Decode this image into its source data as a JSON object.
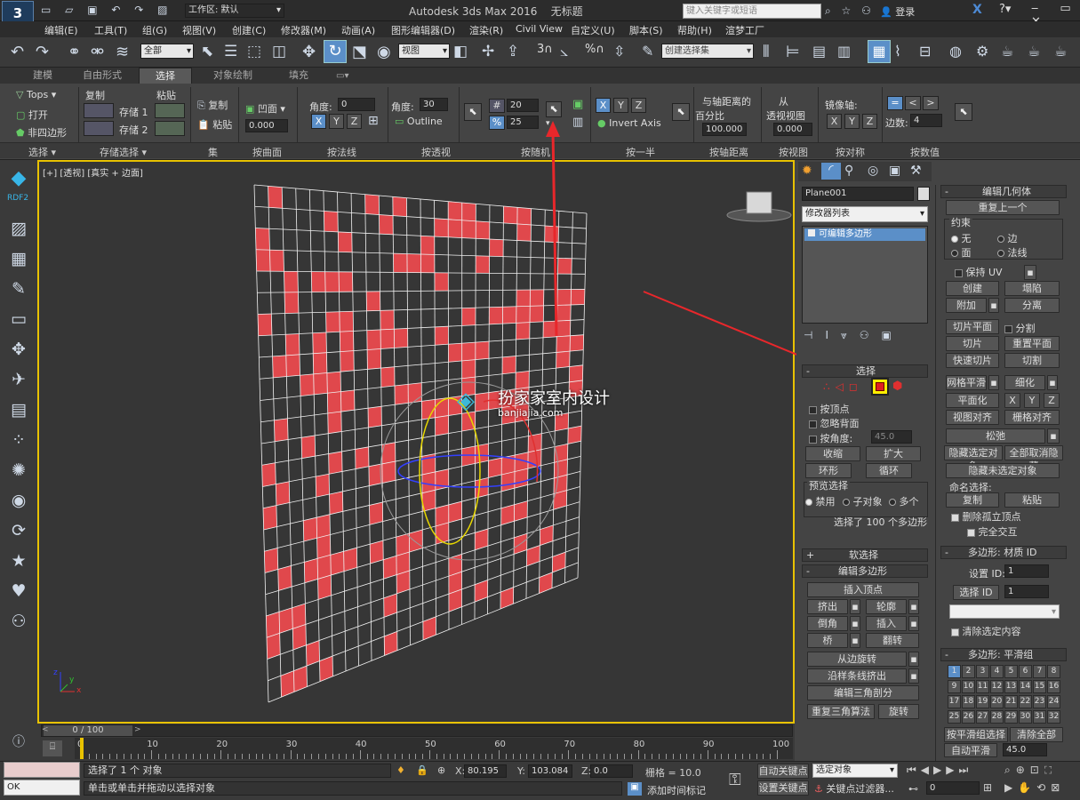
{
  "titlebar": {
    "app_title": "Autodesk 3ds Max 2016",
    "file_name": "无标题",
    "workspace_label": "工作区: 默认",
    "search_placeholder": "键入关键字或短语",
    "login_label": "登录"
  },
  "menu": [
    "编辑(E)",
    "工具(T)",
    "组(G)",
    "视图(V)",
    "创建(C)",
    "修改器(M)",
    "动画(A)",
    "图形编辑器(D)",
    "渲染(R)",
    "Civil View",
    "自定义(U)",
    "脚本(S)",
    "帮助(H)",
    "渲梦工厂"
  ],
  "toolbar": {
    "filter_value": "全部",
    "refcoord_value": "视图",
    "snap_3": "3",
    "snap_pct": "%",
    "selset_value": "创建选择集"
  },
  "ribbon_tabs": [
    "建模",
    "自由形式",
    "选择",
    "对象绘制",
    "填充"
  ],
  "ribbon_active_tab": "选择",
  "ribbon": {
    "sel_tops": "Tops",
    "sel_open": "打开",
    "sel_nonquad": "非四边形",
    "store_copy": "复制",
    "store1": "存储 1",
    "store2": "存储 2",
    "paste": "粘贴",
    "set_copy": "复制",
    "set_paste": "粘贴",
    "concave_label": "凹面",
    "concave_val": "0.000",
    "normal_angle_label": "角度:",
    "normal_angle_val": "0",
    "persp_angle_label": "角度:",
    "persp_angle_val": "30",
    "outline_label": "Outline",
    "random_count": "20",
    "random_pct": "25",
    "half_invert": "Invert Axis",
    "dist_label1": "与轴距离的",
    "dist_label2": "百分比",
    "dist_val": "100.000",
    "view_label1": "从",
    "view_label2": "透视视图",
    "view_val": "0.000",
    "mirror_label": "镜像轴:",
    "sides_label": "边数:",
    "sides_val": "4",
    "xyz": [
      "X",
      "Y",
      "Z"
    ],
    "groups": [
      "选择",
      "存储选择",
      "集",
      "按曲面",
      "按法线",
      "按透视",
      "按随机",
      "按一半",
      "按轴距离",
      "按视图",
      "按对称",
      "按数值"
    ]
  },
  "leftbar": {
    "rdf_label": "RDF2"
  },
  "viewport": {
    "label": "[+] [透视] [真实 + 边面]",
    "watermark_cn": "扮家家室内设计",
    "watermark_url": "banjiajia.com",
    "axis_x": "x",
    "axis_y": "y",
    "axis_z": "z"
  },
  "timeline": {
    "frame_counter": "0 / 100",
    "ticks": [
      "0",
      "10",
      "20",
      "30",
      "40",
      "50",
      "60",
      "70",
      "80",
      "90",
      "100"
    ]
  },
  "cmd": {
    "object_name": "Plane001",
    "modifier_list": "修改器列表",
    "stack_item": "可编辑多边形",
    "sel_title": "选择",
    "by_vertex": "按顶点",
    "ignore_back": "忽略背面",
    "by_angle": "按角度:",
    "angle_val": "45.0",
    "shrink": "收缩",
    "grow": "扩大",
    "ring": "环形",
    "loop": "循环",
    "preview_title": "预览选择",
    "preview_off": "禁用",
    "preview_sub": "子对象",
    "preview_multi": "多个",
    "sel_status": "选择了 100 个多边形",
    "soft_sel": "软选择",
    "edit_poly": "编辑多边形",
    "insert_vertex": "插入顶点",
    "extrude": "挤出",
    "outline": "轮廓",
    "bevel": "倒角",
    "inset": "插入",
    "bridge": "桥",
    "flip": "翻转",
    "hinge": "从边旋转",
    "spline_extrude": "沿样条线挤出",
    "edit_tri": "编辑三角剖分",
    "retri": "重复三角算法",
    "turn": "旋转",
    "edit_geo": "编辑几何体",
    "repeat_last": "重复上一个",
    "constraint_title": "约束",
    "c_none": "无",
    "c_edge": "边",
    "c_face": "面",
    "c_normal": "法线",
    "keep_uv": "保持 UV",
    "create": "创建",
    "collapse": "塌陷",
    "attach": "附加",
    "detach": "分离",
    "slice_plane": "切片平面",
    "split": "分割",
    "slice": "切片",
    "reset_plane": "重置平面",
    "quickslice": "快速切片",
    "cut": "切割",
    "meshsmooth": "网格平滑",
    "tessellate": "细化",
    "make_planar": "平面化",
    "view_align": "视图对齐",
    "grid_align": "栅格对齐",
    "relax": "松弛",
    "hide_sel": "隐藏选定对象",
    "unhide_all": "全部取消隐藏",
    "hide_unsel": "隐藏未选定对象",
    "named_sel": "命名选择:",
    "copy": "复制",
    "paste": "粘贴",
    "del_iso": "删除孤立顶点",
    "full_interact": "完全交互",
    "matid_title": "多边形: 材质 ID",
    "set_id": "设置 ID:",
    "set_id_val": "1",
    "select_id": "选择 ID",
    "select_id_val": "1",
    "clear_sel": "清除选定内容",
    "sg_title": "多边形: 平滑组",
    "sg_select": "按平滑组选择",
    "sg_clear": "清除全部",
    "autosmooth": "自动平滑",
    "autosmooth_val": "45.0",
    "sg_numbers": [
      "1",
      "2",
      "3",
      "4",
      "5",
      "6",
      "7",
      "8",
      "9",
      "10",
      "11",
      "12",
      "13",
      "14",
      "15",
      "16",
      "17",
      "18",
      "19",
      "20",
      "21",
      "22",
      "23",
      "24",
      "25",
      "26",
      "27",
      "28",
      "29",
      "30",
      "31",
      "32"
    ]
  },
  "status": {
    "maxscript_value": "OK",
    "selected": "选择了 1 个 对象",
    "prompt": "单击或单击并拖动以选择对象",
    "x_label": "X:",
    "x_val": "80.195",
    "y_label": "Y:",
    "y_val": "103.084",
    "z_label": "Z:",
    "z_val": "0.0",
    "grid": "栅格 = 10.0",
    "add_time_tag": "添加时间标记",
    "autokey": "自动关键点",
    "setkey": "设置关键点",
    "selected_obj": "选定对象",
    "key_filters": "关键点过滤器...",
    "frame_val": "0"
  },
  "colors": {
    "accent": "#e8c200",
    "poly_red": "#e0484c",
    "annotation_red": "#e8272b",
    "ui_bg": "#444444"
  }
}
